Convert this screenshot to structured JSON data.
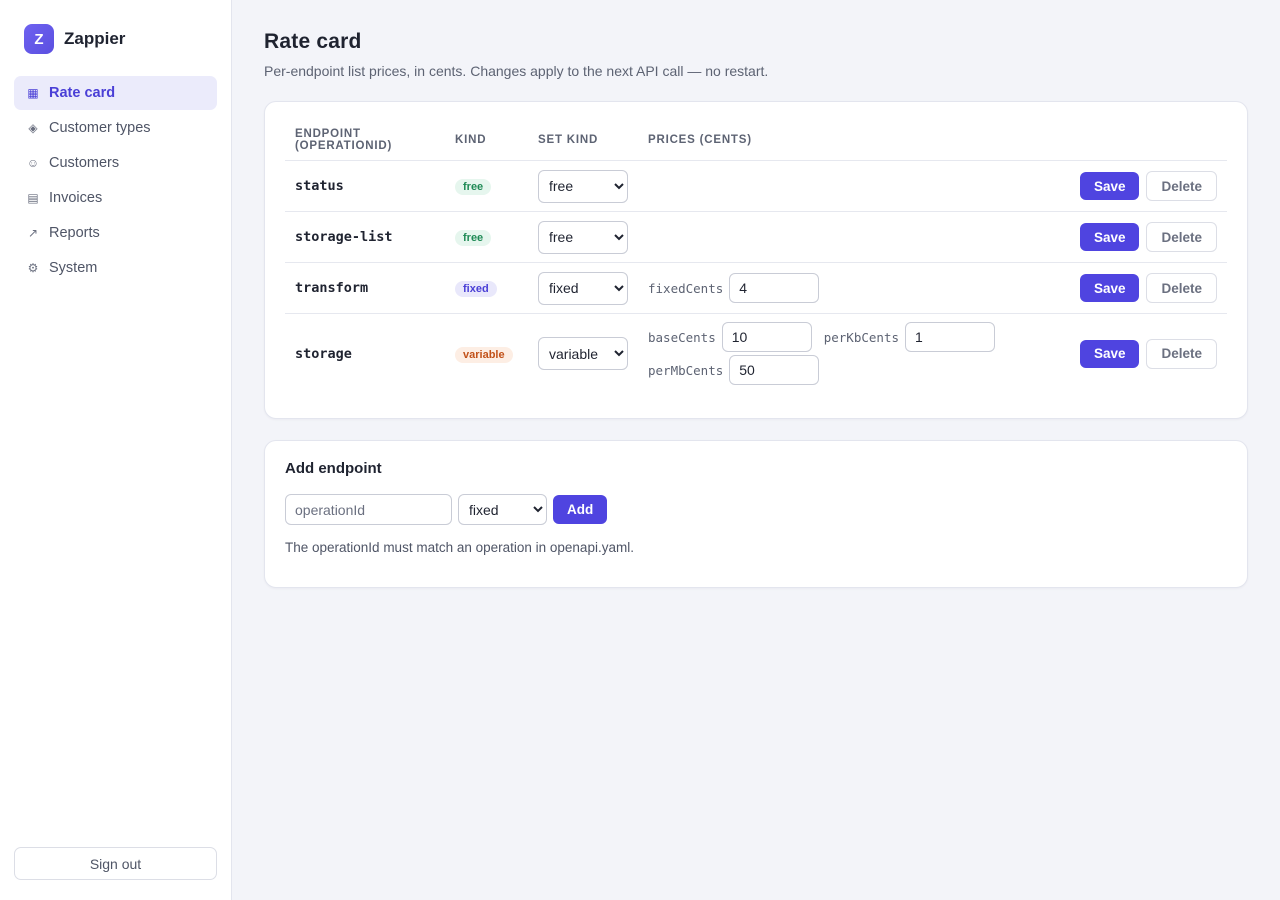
{
  "brand": {
    "logo_letter": "Z",
    "name": "Zappier"
  },
  "sidebar": {
    "items": [
      {
        "label": "Rate card",
        "icon": "grid-icon",
        "glyph": "▦",
        "active": true
      },
      {
        "label": "Customer types",
        "icon": "diamond-icon",
        "glyph": "◈",
        "active": false
      },
      {
        "label": "Customers",
        "icon": "smiley-icon",
        "glyph": "☺",
        "active": false
      },
      {
        "label": "Invoices",
        "icon": "list-icon",
        "glyph": "▤",
        "active": false
      },
      {
        "label": "Reports",
        "icon": "trend-arrow-icon",
        "glyph": "↗",
        "active": false
      },
      {
        "label": "System",
        "icon": "gear-icon",
        "glyph": "⚙",
        "active": false
      }
    ],
    "sign_out": "Sign out"
  },
  "page": {
    "title": "Rate card",
    "subtitle": "Per-endpoint list prices, in cents. Changes apply to the next API call — no restart."
  },
  "table": {
    "headers": [
      "Endpoint (operationId)",
      "Kind",
      "Set kind",
      "Prices (cents)"
    ],
    "kind_options": [
      "free",
      "fixed",
      "variable"
    ],
    "save_label": "Save",
    "delete_label": "Delete",
    "rows": [
      {
        "operationId": "status",
        "kind": "free",
        "set_kind": "free",
        "prices": []
      },
      {
        "operationId": "storage-list",
        "kind": "free",
        "set_kind": "free",
        "prices": []
      },
      {
        "operationId": "transform",
        "kind": "fixed",
        "set_kind": "fixed",
        "prices": [
          {
            "label": "fixedCents",
            "value": "4"
          }
        ]
      },
      {
        "operationId": "storage",
        "kind": "variable",
        "set_kind": "variable",
        "prices": [
          {
            "label": "baseCents",
            "value": "10"
          },
          {
            "label": "perKbCents",
            "value": "1"
          },
          {
            "label": "perMbCents",
            "value": "50"
          }
        ]
      }
    ]
  },
  "add_endpoint": {
    "title": "Add endpoint",
    "placeholder": "operationId",
    "kind_selected": "fixed",
    "add_label": "Add",
    "hint": "The operationId must match an operation in openapi.yaml."
  },
  "colors": {
    "accent": "#4f44e0",
    "free_badge": "#1f8a55",
    "fixed_badge": "#4a3fd6",
    "variable_badge": "#c2521a"
  }
}
